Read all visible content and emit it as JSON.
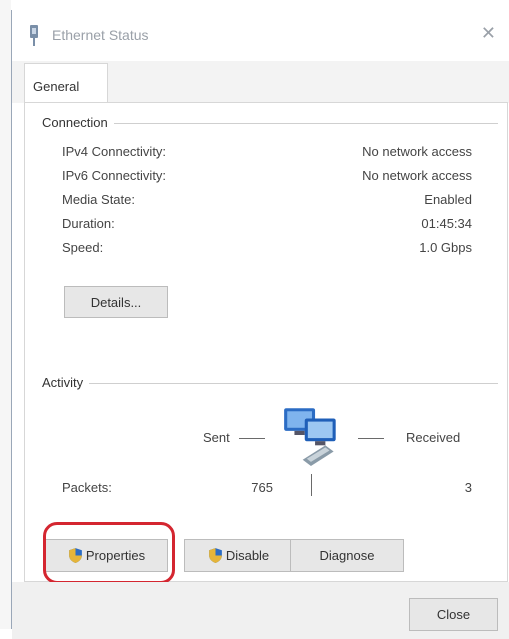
{
  "window": {
    "title": "Ethernet Status",
    "close_glyph": "✕"
  },
  "tabs": [
    {
      "label": "General"
    }
  ],
  "connection": {
    "label": "Connection",
    "rows": [
      {
        "label": "IPv4 Connectivity:",
        "value": "No network access"
      },
      {
        "label": "IPv6 Connectivity:",
        "value": "No network access"
      },
      {
        "label": "Media State:",
        "value": "Enabled"
      },
      {
        "label": "Duration:",
        "value": "01:45:34"
      },
      {
        "label": "Speed:",
        "value": "1.0 Gbps"
      }
    ],
    "details_button": "Details..."
  },
  "activity": {
    "label": "Activity",
    "sent_label": "Sent",
    "received_label": "Received",
    "packets_label": "Packets:",
    "packets_sent": "765",
    "packets_received": "3"
  },
  "buttons": {
    "properties": "Properties",
    "disable": "Disable",
    "diagnose": "Diagnose",
    "close": "Close"
  },
  "icons": {
    "title": "network-adapter-icon",
    "activity": "network-computers-icon",
    "properties": "shield-icon",
    "disable": "shield-icon"
  },
  "colors": {
    "highlight": "#d42630",
    "accent": "#2b6cc4"
  }
}
